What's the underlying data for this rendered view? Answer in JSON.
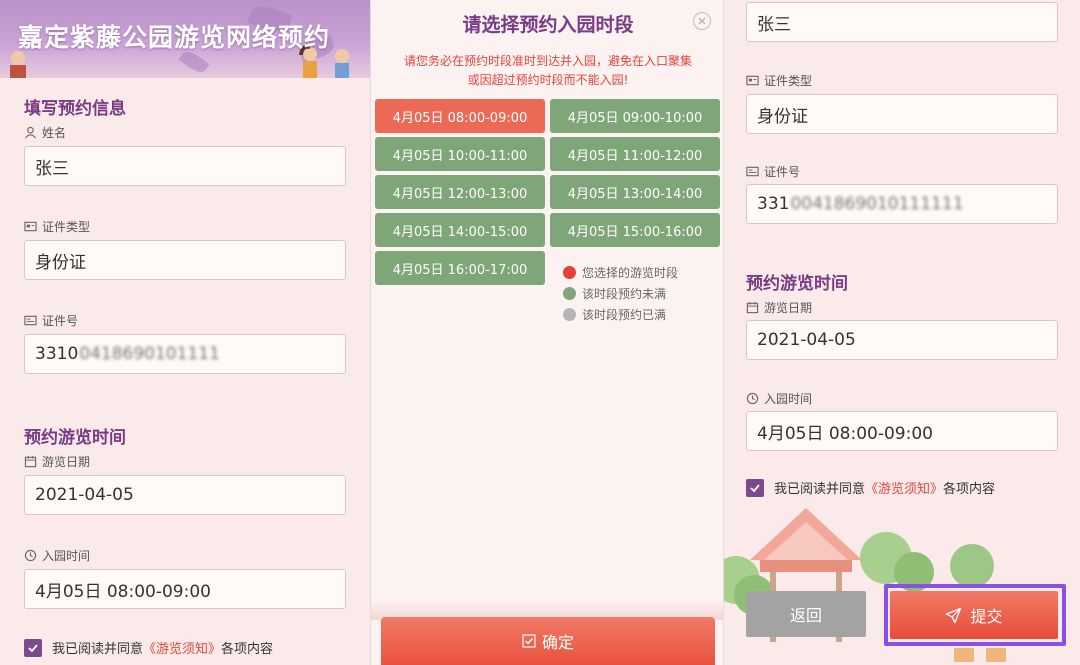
{
  "app_title": "嘉定紫藤公园游览网络预约",
  "form": {
    "section_info": "填写预约信息",
    "name_label": "姓名",
    "name_value": "张三",
    "id_type_label": "证件类型",
    "id_type_value": "身份证",
    "id_no_label": "证件号",
    "id_no_visible": "3310",
    "id_no_blurred": "0418690101111",
    "section_time": "预约游览时间",
    "date_label": "游览日期",
    "date_value": "2021-04-05",
    "entry_label": "入园时间",
    "entry_value": "4月05日 08:00-09:00",
    "agree_prefix": "我已阅读并同意",
    "agree_link": "《游览须知》",
    "agree_suffix": "各项内容"
  },
  "right_form": {
    "name_value": "张三",
    "id_no_visible": "331",
    "id_no_blurred": "0041869010111111"
  },
  "modal": {
    "title": "请选择预约入园时段",
    "note_line1": "请您务必在预约时段准时到达并入园，避免在入口聚集",
    "note_line2": "或因超过预约时段而不能入园!",
    "slots": [
      {
        "label": "4月05日 08:00-09:00",
        "state": "selected"
      },
      {
        "label": "4月05日 09:00-10:00",
        "state": "available"
      },
      {
        "label": "4月05日 10:00-11:00",
        "state": "available"
      },
      {
        "label": "4月05日 11:00-12:00",
        "state": "available"
      },
      {
        "label": "4月05日 12:00-13:00",
        "state": "available"
      },
      {
        "label": "4月05日 13:00-14:00",
        "state": "available"
      },
      {
        "label": "4月05日 14:00-15:00",
        "state": "available"
      },
      {
        "label": "4月05日 15:00-16:00",
        "state": "available"
      },
      {
        "label": "4月05日 16:00-17:00",
        "state": "available"
      }
    ],
    "legend": [
      {
        "label": "您选择的游览时段",
        "color": "#e2413a"
      },
      {
        "label": "该时段预约未满",
        "color": "#7fa678"
      },
      {
        "label": "该时段预约已满",
        "color": "#b5b5b5"
      }
    ],
    "confirm_label": "确定"
  },
  "actions": {
    "back_label": "返回",
    "submit_label": "提交"
  },
  "colors": {
    "accent_purple": "#7a3b86",
    "slot_available": "#7fa678",
    "slot_selected": "#ec6a55",
    "primary_button": "#e9523e",
    "highlight_box": "#8c4fe6"
  }
}
